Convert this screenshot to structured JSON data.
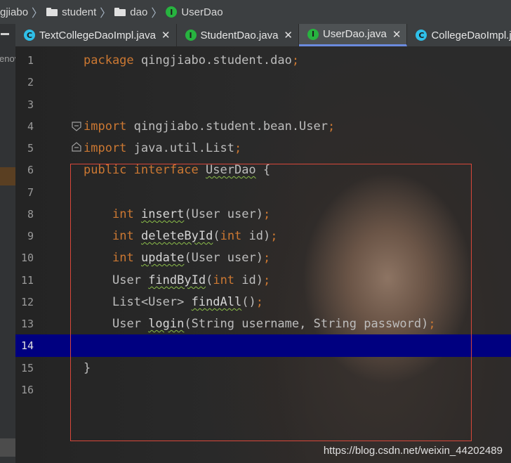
{
  "breadcrumb": [
    {
      "label": "gjiabo",
      "icon": null
    },
    {
      "label": "student",
      "icon": "folder-icon"
    },
    {
      "label": "dao",
      "icon": "folder-icon"
    },
    {
      "label": "UserDao",
      "icon": "interface-icon"
    }
  ],
  "sidebar": {
    "partial_text": "enov"
  },
  "tabs": [
    {
      "label": "TextCollegeDaoImpl.java",
      "icon": "class-icon",
      "closable": true,
      "active": false
    },
    {
      "label": "StudentDao.java",
      "icon": "interface-icon",
      "closable": true,
      "active": false
    },
    {
      "label": "UserDao.java",
      "icon": "interface-icon",
      "closable": true,
      "active": true
    },
    {
      "label": "CollegeDaoImpl.java",
      "icon": "class-icon",
      "closable": false,
      "active": false
    }
  ],
  "editor": {
    "line_numbers": [
      "1",
      "2",
      "3",
      "4",
      "5",
      "6",
      "7",
      "8",
      "9",
      "10",
      "11",
      "12",
      "13",
      "14",
      "15",
      "16"
    ],
    "current_line": 14,
    "code": {
      "l1_kw": "package",
      "l1_rest": " qingjiabo.student.dao",
      "l1_semi": ";",
      "l4_kw": "import",
      "l4_rest": " qingjiabo.student.bean.User",
      "l4_semi": ";",
      "l5_kw": "import",
      "l5_rest": " java.util.List",
      "l5_semi": ";",
      "l6_kw1": "public",
      "l6_kw2": " interface ",
      "l6_name": "UserDao",
      "l6_rest": " {",
      "l8_type": "int",
      "l8_method": "insert",
      "l8_args": "(User user)",
      "l8_semi": ";",
      "l9_type": "int",
      "l9_method": "deleteById",
      "l9_args_open": "(",
      "l9_arg_type": "int",
      "l9_args_close": " id)",
      "l9_semi": ";",
      "l10_type": "int",
      "l10_method": "update",
      "l10_args": "(User user)",
      "l10_semi": ";",
      "l11_type": "User ",
      "l11_method": "findById",
      "l11_args_open": "(",
      "l11_arg_type": "int",
      "l11_args_close": " id)",
      "l11_semi": ";",
      "l12_type": "List<User> ",
      "l12_method": "findAll",
      "l12_args": "()",
      "l12_semi": ";",
      "l13_type": "User ",
      "l13_method": "login",
      "l13_args": "(String username, String password)",
      "l13_semi": ";",
      "l15": "}"
    }
  },
  "watermark": "https://blog.csdn.net/weixin_44202489",
  "colors": {
    "keyword": "#cc7832",
    "current_line": "#000080",
    "annotation_box": "#d9473a",
    "active_tab_underline": "#6b8bde"
  }
}
